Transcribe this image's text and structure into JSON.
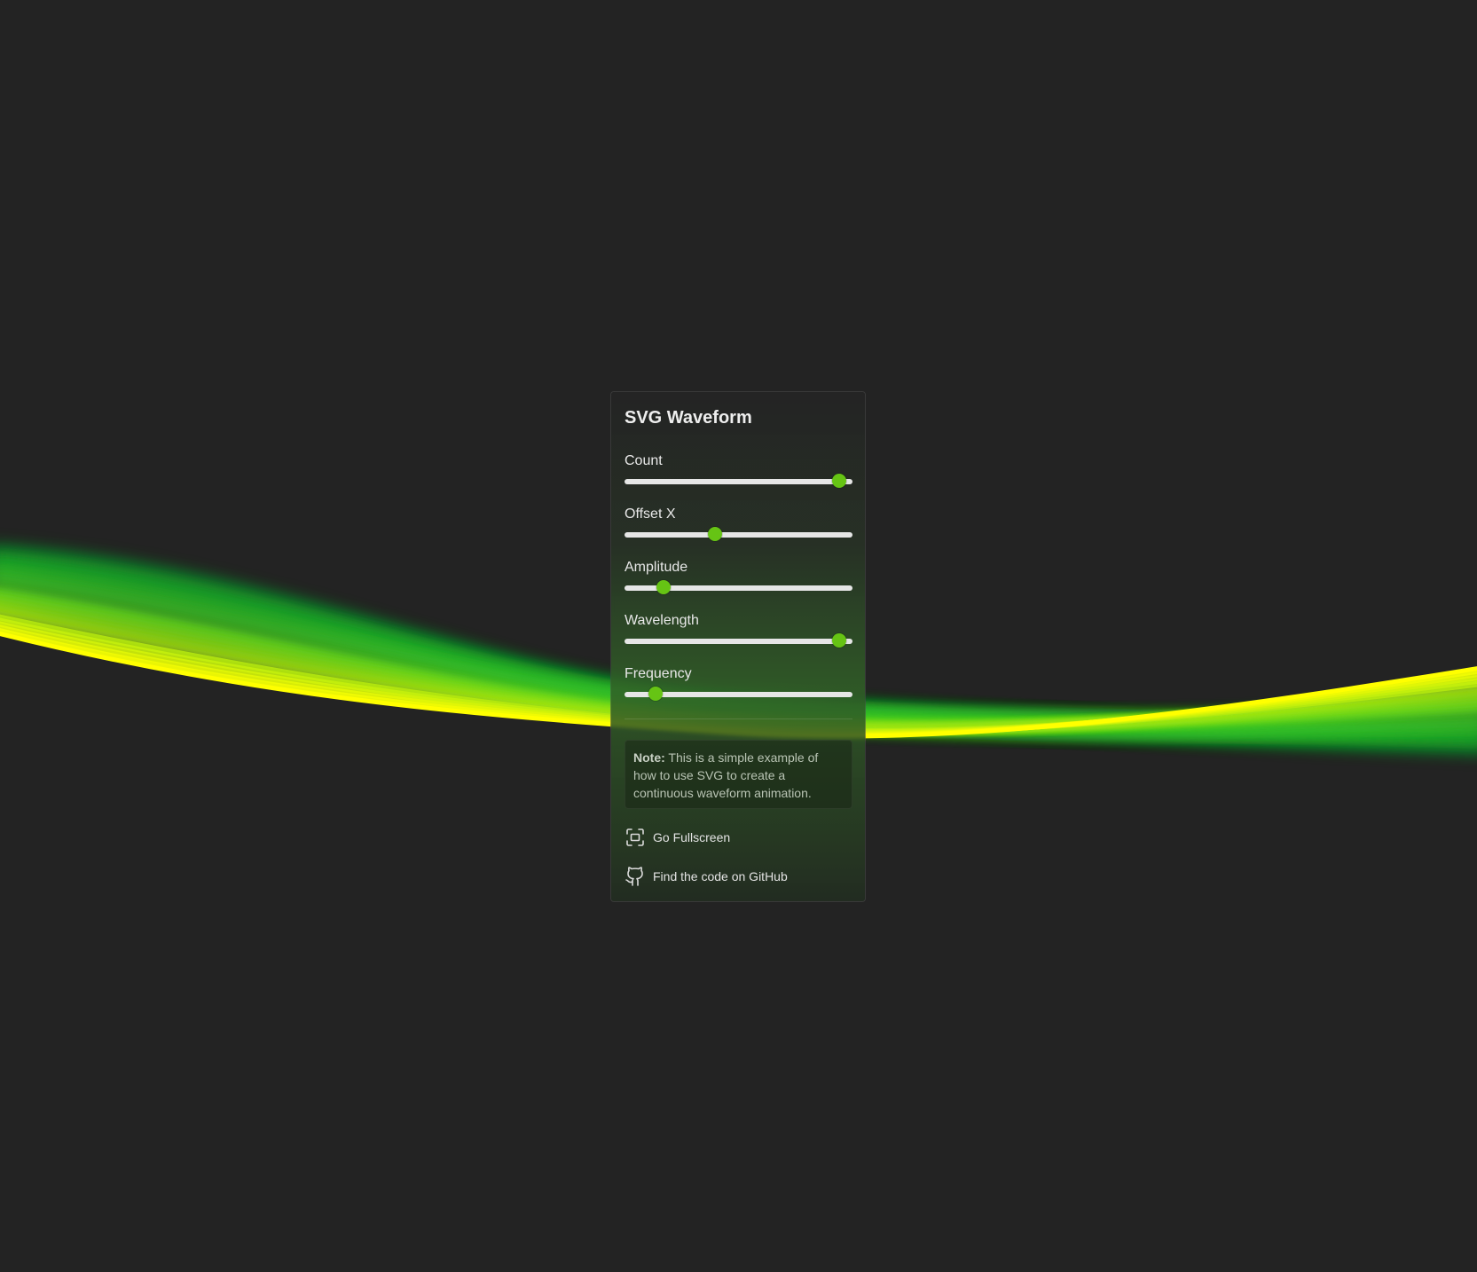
{
  "panel": {
    "title": "SVG Waveform"
  },
  "controls": [
    {
      "label": "Count",
      "value_fraction": 0.97
    },
    {
      "label": "Offset X",
      "value_fraction": 0.39
    },
    {
      "label": "Amplitude",
      "value_fraction": 0.15
    },
    {
      "label": "Wavelength",
      "value_fraction": 0.97
    },
    {
      "label": "Frequency",
      "value_fraction": 0.11
    }
  ],
  "note": {
    "prefix": "Note:",
    "text": " This is a simple example of how to use SVG to create a continuous waveform animation."
  },
  "links": {
    "fullscreen": {
      "label": "Go Fullscreen",
      "icon": "fullscreen-icon"
    },
    "github": {
      "label": "Find the code on GitHub",
      "icon": "github-icon"
    }
  },
  "colors": {
    "background": "#232323",
    "accent": "#66c414",
    "wave_yellow": "#ffff00",
    "wave_green": "#22dd22",
    "track": "#e6e6e6"
  }
}
